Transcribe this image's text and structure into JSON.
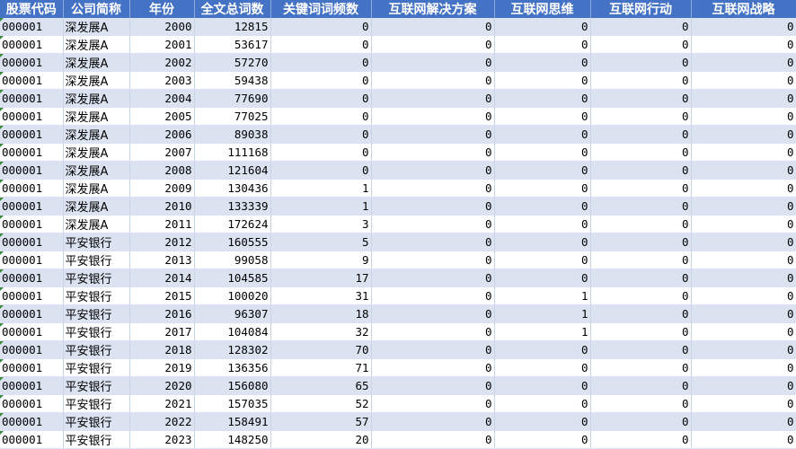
{
  "headers": [
    "股票代码",
    "公司简称",
    "年份",
    "全文总词数",
    "关键词词频数",
    "互联网解决方案",
    "互联网思维",
    "互联网行动",
    "互联网战略"
  ],
  "rows": [
    [
      "000001",
      "深发展A",
      "2000",
      "12815",
      "0",
      "0",
      "0",
      "0",
      "0"
    ],
    [
      "000001",
      "深发展A",
      "2001",
      "53617",
      "0",
      "0",
      "0",
      "0",
      "0"
    ],
    [
      "000001",
      "深发展A",
      "2002",
      "57270",
      "0",
      "0",
      "0",
      "0",
      "0"
    ],
    [
      "000001",
      "深发展A",
      "2003",
      "59438",
      "0",
      "0",
      "0",
      "0",
      "0"
    ],
    [
      "000001",
      "深发展A",
      "2004",
      "77690",
      "0",
      "0",
      "0",
      "0",
      "0"
    ],
    [
      "000001",
      "深发展A",
      "2005",
      "77025",
      "0",
      "0",
      "0",
      "0",
      "0"
    ],
    [
      "000001",
      "深发展A",
      "2006",
      "89038",
      "0",
      "0",
      "0",
      "0",
      "0"
    ],
    [
      "000001",
      "深发展A",
      "2007",
      "111168",
      "0",
      "0",
      "0",
      "0",
      "0"
    ],
    [
      "000001",
      "深发展A",
      "2008",
      "121604",
      "0",
      "0",
      "0",
      "0",
      "0"
    ],
    [
      "000001",
      "深发展A",
      "2009",
      "130436",
      "1",
      "0",
      "0",
      "0",
      "0"
    ],
    [
      "000001",
      "深发展A",
      "2010",
      "133339",
      "1",
      "0",
      "0",
      "0",
      "0"
    ],
    [
      "000001",
      "深发展A",
      "2011",
      "172624",
      "3",
      "0",
      "0",
      "0",
      "0"
    ],
    [
      "000001",
      "平安银行",
      "2012",
      "160555",
      "5",
      "0",
      "0",
      "0",
      "0"
    ],
    [
      "000001",
      "平安银行",
      "2013",
      "99058",
      "9",
      "0",
      "0",
      "0",
      "0"
    ],
    [
      "000001",
      "平安银行",
      "2014",
      "104585",
      "17",
      "0",
      "0",
      "0",
      "0"
    ],
    [
      "000001",
      "平安银行",
      "2015",
      "100020",
      "31",
      "0",
      "1",
      "0",
      "0"
    ],
    [
      "000001",
      "平安银行",
      "2016",
      "96307",
      "18",
      "0",
      "1",
      "0",
      "0"
    ],
    [
      "000001",
      "平安银行",
      "2017",
      "104084",
      "32",
      "0",
      "1",
      "0",
      "0"
    ],
    [
      "000001",
      "平安银行",
      "2018",
      "128302",
      "70",
      "0",
      "0",
      "0",
      "0"
    ],
    [
      "000001",
      "平安银行",
      "2019",
      "136356",
      "71",
      "0",
      "0",
      "0",
      "0"
    ],
    [
      "000001",
      "平安银行",
      "2020",
      "156080",
      "65",
      "0",
      "0",
      "0",
      "0"
    ],
    [
      "000001",
      "平安银行",
      "2021",
      "157035",
      "52",
      "0",
      "0",
      "0",
      "0"
    ],
    [
      "000001",
      "平安银行",
      "2022",
      "158491",
      "57",
      "0",
      "0",
      "0",
      "0"
    ],
    [
      "000001",
      "平安银行",
      "2023",
      "148250",
      "20",
      "0",
      "0",
      "0",
      "0"
    ]
  ],
  "colors": {
    "header_bg": "#4472c4",
    "band_bg": "#dbe3f1",
    "error_marker": "#3a8a3a"
  }
}
